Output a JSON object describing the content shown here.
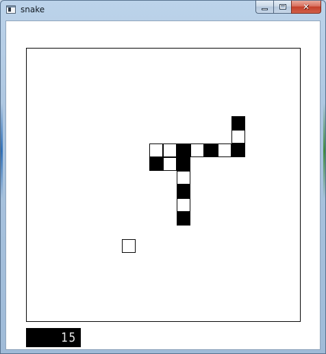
{
  "window": {
    "title": "snake",
    "icon": "window-app-icon",
    "controls": {
      "minimize_icon": "minimize-icon",
      "maximize_icon": "maximize-icon",
      "close_glyph": "✕"
    }
  },
  "game": {
    "grid_columns": 20,
    "grid_rows": 20,
    "snake": [
      {
        "col": 15,
        "row": 5,
        "shade": "dark"
      },
      {
        "col": 15,
        "row": 6,
        "shade": "light"
      },
      {
        "col": 15,
        "row": 7,
        "shade": "dark"
      },
      {
        "col": 14,
        "row": 7,
        "shade": "light"
      },
      {
        "col": 13,
        "row": 7,
        "shade": "dark"
      },
      {
        "col": 12,
        "row": 7,
        "shade": "light"
      },
      {
        "col": 11,
        "row": 7,
        "shade": "dark"
      },
      {
        "col": 10,
        "row": 7,
        "shade": "light"
      },
      {
        "col": 9,
        "row": 7,
        "shade": "light"
      },
      {
        "col": 9,
        "row": 8,
        "shade": "dark"
      },
      {
        "col": 10,
        "row": 8,
        "shade": "light"
      },
      {
        "col": 11,
        "row": 8,
        "shade": "dark"
      },
      {
        "col": 11,
        "row": 9,
        "shade": "light"
      },
      {
        "col": 11,
        "row": 10,
        "shade": "dark"
      },
      {
        "col": 11,
        "row": 11,
        "shade": "light"
      },
      {
        "col": 11,
        "row": 12,
        "shade": "dark"
      }
    ],
    "food": {
      "col": 7,
      "row": 14,
      "shade": "light"
    },
    "score": "15"
  },
  "colors": {
    "cell_dark": "#000000",
    "cell_light": "#ffffff",
    "score_background": "#000000",
    "score_digits": "#e8e8e8"
  }
}
